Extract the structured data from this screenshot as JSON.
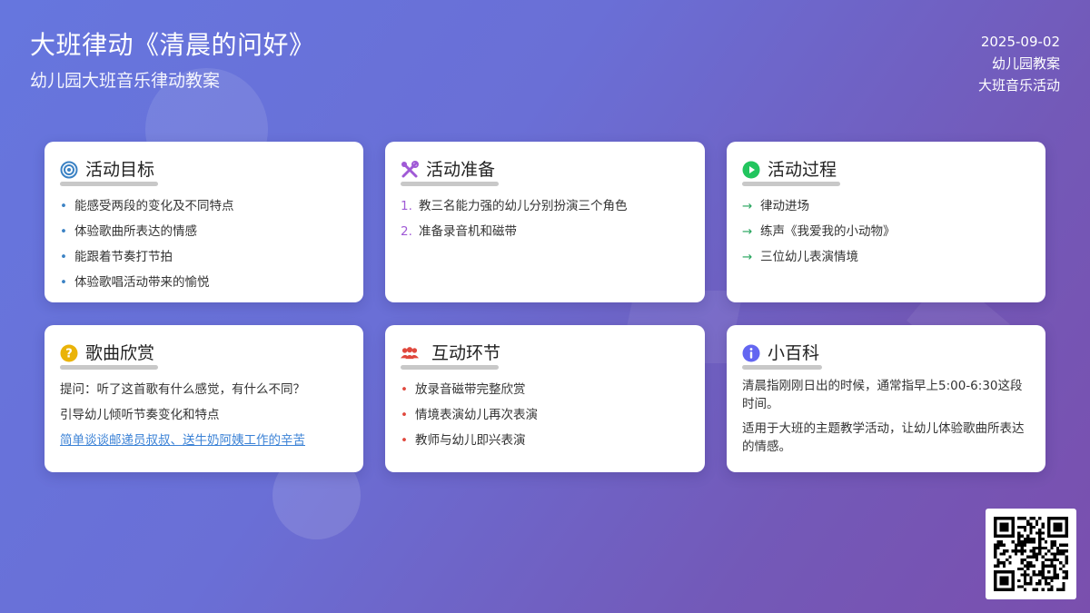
{
  "header": {
    "title": "大班律动《清晨的问好》",
    "subtitle": "幼儿园大班音乐律动教案",
    "date": "2025-09-02",
    "tag1": "幼儿园教案",
    "tag2": "大班音乐活动"
  },
  "cards": [
    {
      "title": "活动目标",
      "icon": "target-icon",
      "items": [
        "能感受两段的变化及不同特点",
        "体验歌曲所表达的情感",
        "能跟着节奏打节拍",
        "体验歌唱活动带来的愉悦"
      ]
    },
    {
      "title": "活动准备",
      "icon": "tools-icon",
      "items": [
        "教三名能力强的幼儿分别扮演三个角色",
        "准备录音机和磁带"
      ],
      "markers": [
        "1.",
        "2."
      ]
    },
    {
      "title": "活动过程",
      "icon": "play-icon",
      "items": [
        "律动进场",
        "练声《我爱我的小动物》",
        "三位幼儿表演情境"
      ],
      "marker": "→"
    },
    {
      "title": "歌曲欣赏",
      "icon": "question-icon",
      "lines": [
        "提问：听了这首歌有什么感觉，有什么不同？",
        "引导幼儿倾听节奏变化和特点"
      ],
      "link": "简单谈谈邮递员叔叔、送牛奶阿姨工作的辛苦"
    },
    {
      "title": "互动环节",
      "icon": "users-icon",
      "items": [
        "放录音磁带完整欣赏",
        "情境表演幼儿再次表演",
        "教师与幼儿即兴表演"
      ]
    },
    {
      "title": "小百科",
      "icon": "info-icon",
      "paragraphs": [
        "清晨指刚刚日出的时候，通常指早上5:00-6:30这段时间。",
        "适用于大班的主题教学活动，让幼儿体验歌曲所表达的情感。"
      ]
    }
  ],
  "bullet": "•",
  "colors": {
    "accent_blue": "#3b82c4",
    "accent_purple": "#a05ad6",
    "accent_green": "#22c55e",
    "accent_yellow": "#eab308",
    "accent_red": "#e0483d",
    "accent_indigo": "#6366f1"
  }
}
